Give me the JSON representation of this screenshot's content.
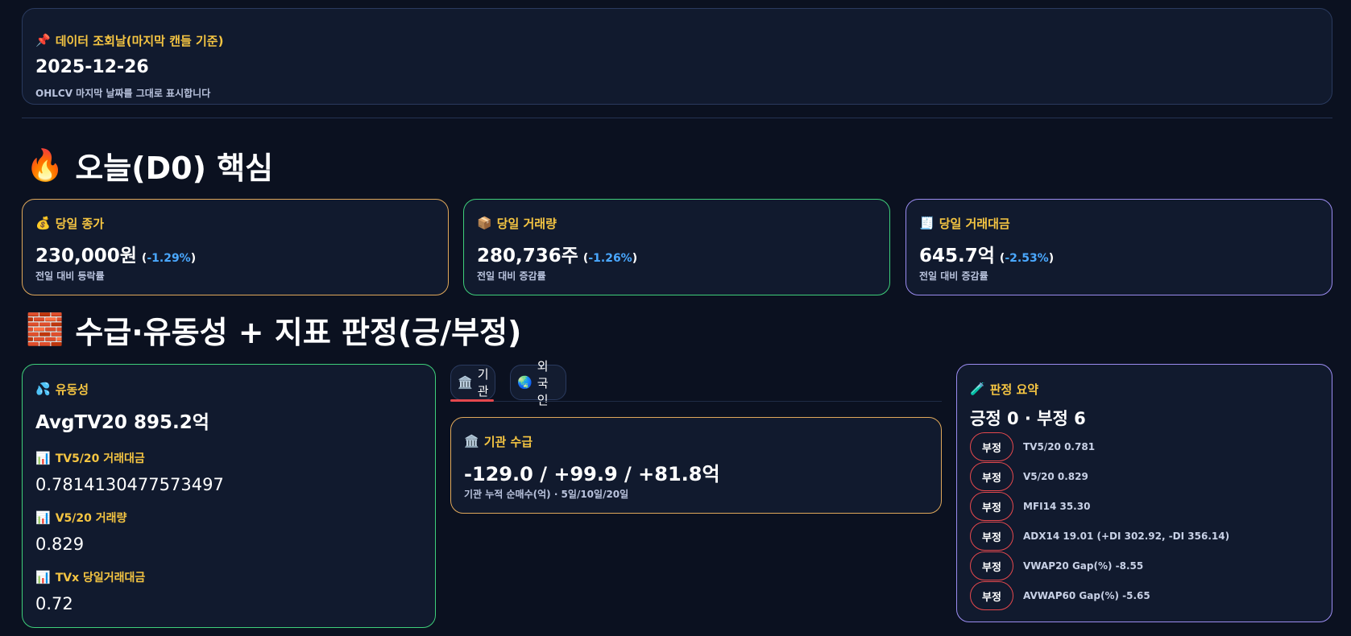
{
  "date_card": {
    "title": "데이터 조회날(마지막 캔들 기준)",
    "date": "2025-12-26",
    "note": "OHLCV 마지막 날짜를 그대로 표시합니다"
  },
  "section1": {
    "title": "오늘(D0) 핵심"
  },
  "metrics": [
    {
      "title": "당일 종가",
      "value": "230,000원",
      "open": "(",
      "pct": "-1.29%",
      "close": ")",
      "sub": "전일 대비 등락률"
    },
    {
      "title": "당일 거래량",
      "value": "280,736주",
      "open": "(",
      "pct": "-1.26%",
      "close": ")",
      "sub": "전일 대비 증감률"
    },
    {
      "title": "당일 거래대금",
      "value": "645.7억",
      "open": "(",
      "pct": "-2.53%",
      "close": ")",
      "sub": "전일 대비 증감률"
    }
  ],
  "section2": {
    "title": "수급·유동성 + 지표 판정(긍/부정)"
  },
  "liquidity": {
    "title": "유동성",
    "avg": "AvgTV20 895.2억",
    "items": [
      {
        "label": "TV5/20 거래대금",
        "value": "0.7814130477573497"
      },
      {
        "label": "V5/20 거래량",
        "value": "0.829"
      },
      {
        "label": "TVx 당일거래대금",
        "value": "0.72"
      }
    ]
  },
  "tabs": [
    {
      "label": "기관"
    },
    {
      "label": "외국인"
    }
  ],
  "institution": {
    "title": "기관 수급",
    "value": "-129.0 / +99.9 / +81.8억",
    "sub": "기관 누적 순매수(억) · 5일/10일/20일"
  },
  "judgement": {
    "title": "판정 요약",
    "summary": "긍정 0 · 부정 6",
    "rows": [
      {
        "badge": "부정",
        "text": "TV5/20 0.781"
      },
      {
        "badge": "부정",
        "text": "V5/20 0.829"
      },
      {
        "badge": "부정",
        "text": "MFI14 35.30"
      },
      {
        "badge": "부정",
        "text": "ADX14 19.01 (+DI 302.92, -DI 356.14)"
      },
      {
        "badge": "부정",
        "text": "VWAP20 Gap(%) -8.55"
      },
      {
        "badge": "부정",
        "text": "AVWAP60 Gap(%) -5.65"
      }
    ]
  },
  "colors": {
    "accent_title": "#f5c542",
    "pct_negative": "#4aa8ff",
    "negative_badge": "#e5484d",
    "border_orange": "#e0a85a",
    "border_green": "#3ecf7a",
    "border_purple": "#9b8cf0"
  },
  "icons": {
    "date": "pushpin-icon",
    "section1": "fire-icon",
    "close": "money-bag-icon",
    "volume": "package-icon",
    "value": "receipt-icon",
    "section2": "brick-icon",
    "liquidity": "droplets-icon",
    "chart": "bar-chart-icon",
    "institution": "bank-icon",
    "foreign": "globe-icon",
    "judgement": "test-tube-icon"
  }
}
